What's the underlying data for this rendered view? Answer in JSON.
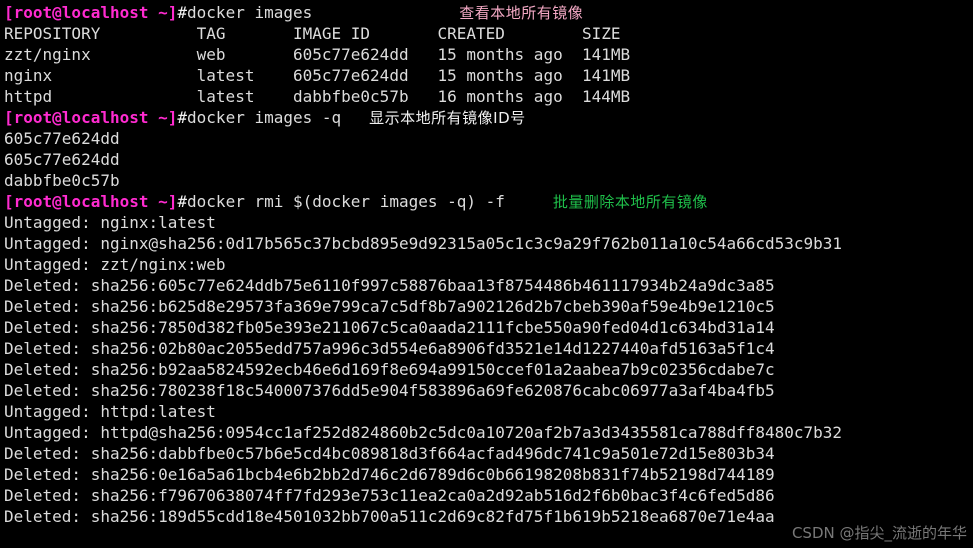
{
  "terminal": {
    "title": "root@localhost terminal",
    "background_color": "#000000",
    "foreground_color": "#dcdcdc",
    "prompt_color": "#ff2bd0",
    "note_pink_color": "#f3a8c4",
    "note_white_color": "#f0f0f0",
    "note_green_color": "#1fbf4a",
    "prompt": "[root@localhost ~]",
    "prompt_symbol": "#"
  },
  "commands": {
    "cmd1": "docker images",
    "cmd2": "docker images -q",
    "cmd3": "docker rmi $(docker images -q) -f"
  },
  "annotations": {
    "note1": "查看本地所有镜像",
    "note2": "显示本地所有镜像ID号",
    "note3": "批量删除本地所有镜像"
  },
  "images_table": {
    "headers": {
      "repository": "REPOSITORY",
      "tag": "TAG",
      "image_id": "IMAGE ID",
      "created": "CREATED",
      "size": "SIZE"
    },
    "header_line": "REPOSITORY          TAG       IMAGE ID       CREATED        SIZE",
    "rows": [
      {
        "line": "zzt/nginx           web       605c77e624dd   15 months ago  141MB",
        "repository": "zzt/nginx",
        "tag": "web",
        "image_id": "605c77e624dd",
        "created": "15 months ago",
        "size": "141MB"
      },
      {
        "line": "nginx               latest    605c77e624dd   15 months ago  141MB",
        "repository": "nginx",
        "tag": "latest",
        "image_id": "605c77e624dd",
        "created": "15 months ago",
        "size": "141MB"
      },
      {
        "line": "httpd               latest    dabbfbe0c57b   16 months ago  144MB",
        "repository": "httpd",
        "tag": "latest",
        "image_id": "dabbfbe0c57b",
        "created": "16 months ago",
        "size": "144MB"
      }
    ]
  },
  "image_ids": [
    "605c77e624dd",
    "605c77e624dd",
    "dabbfbe0c57b"
  ],
  "rmi_output": [
    "Untagged: nginx:latest",
    "Untagged: nginx@sha256:0d17b565c37bcbd895e9d92315a05c1c3c9a29f762b011a10c54a66cd53c9b31",
    "Untagged: zzt/nginx:web",
    "Deleted: sha256:605c77e624ddb75e6110f997c58876baa13f8754486b461117934b24a9dc3a85",
    "Deleted: sha256:b625d8e29573fa369e799ca7c5df8b7a902126d2b7cbeb390af59e4b9e1210c5",
    "Deleted: sha256:7850d382fb05e393e211067c5ca0aada2111fcbe550a90fed04d1c634bd31a14",
    "Deleted: sha256:02b80ac2055edd757a996c3d554e6a8906fd3521e14d1227440afd5163a5f1c4",
    "Deleted: sha256:b92aa5824592ecb46e6d169f8e694a99150ccef01a2aabea7b9c02356cdabe7c",
    "Deleted: sha256:780238f18c540007376dd5e904f583896a69fe620876cabc06977a3af4ba4fb5",
    "Untagged: httpd:latest",
    "Untagged: httpd@sha256:0954cc1af252d824860b2c5dc0a10720af2b7a3d3435581ca788dff8480c7b32",
    "Deleted: sha256:dabbfbe0c57b6e5cd4bc089818d3f664acfad496dc741c9a501e72d15e803b34",
    "Deleted: sha256:0e16a5a61bcb4e6b2bb2d746c2d6789d6c0b66198208b831f74b52198d744189",
    "Deleted: sha256:f79670638074ff7fd293e753c11ea2ca0a2d92ab516d2f6b0bac3f4c6fed5d86",
    "Deleted: sha256:189d55cdd18e4501032bb700a511c2d69c82fd75f1b619b5218ea6870e71e4aa"
  ],
  "watermark": "CSDN @指尖_流逝的年华"
}
